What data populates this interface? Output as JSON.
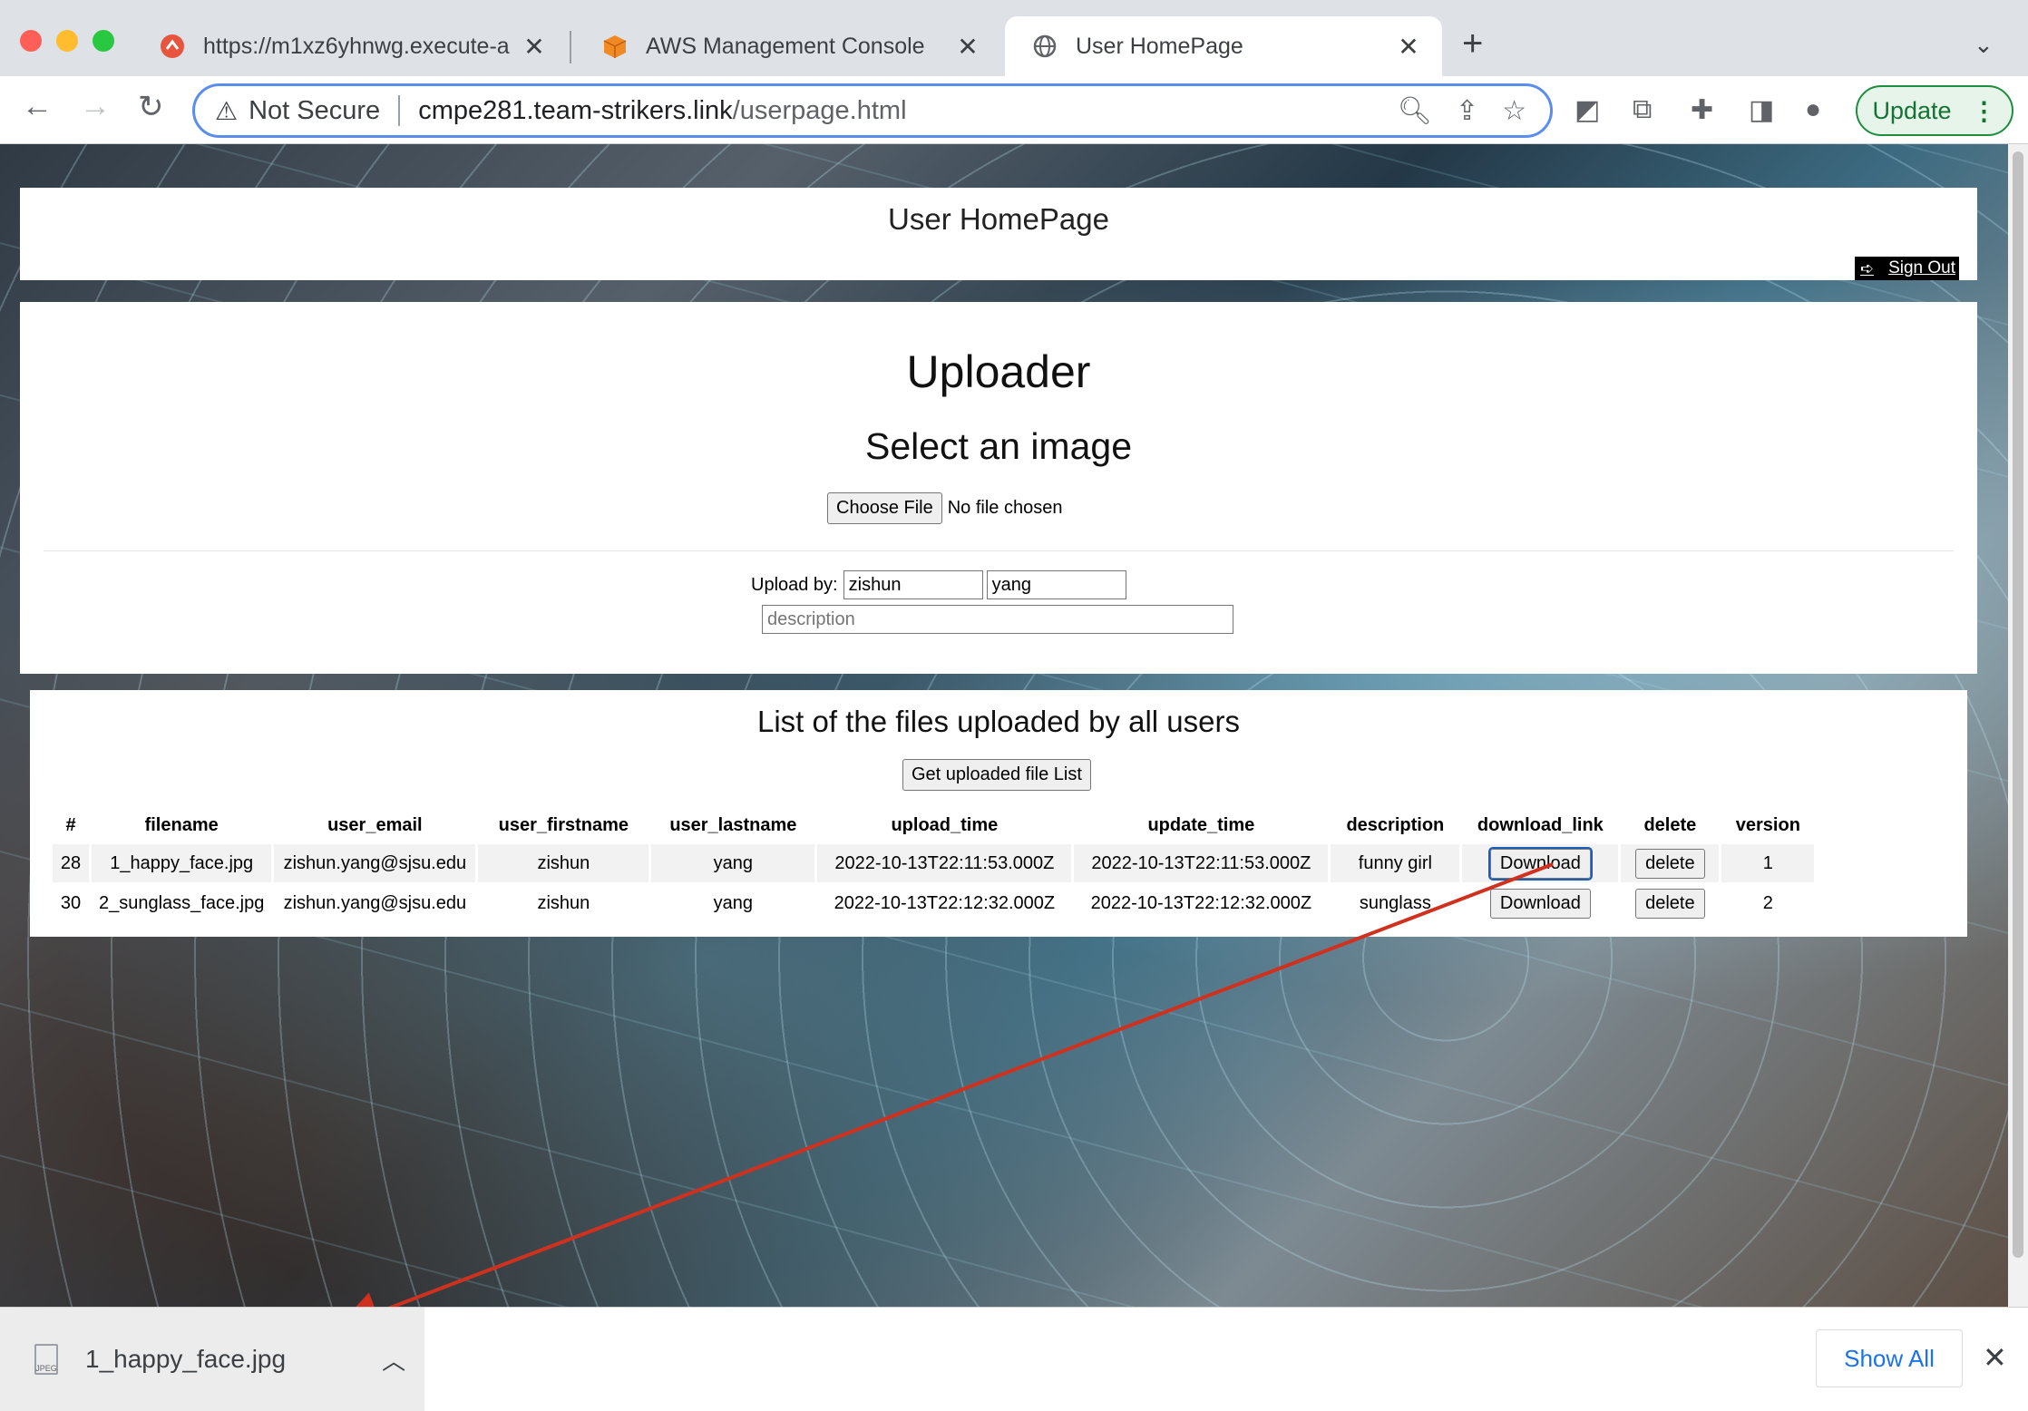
{
  "tabs": [
    {
      "title": "https://m1xz6yhnwg.execute-a",
      "icon": "api-gateway-icon"
    },
    {
      "title": "AWS Management Console",
      "icon": "aws-cube-icon"
    },
    {
      "title": "User HomePage",
      "icon": "globe-icon"
    }
  ],
  "toolbar": {
    "security_label": "Not Secure",
    "url_host": "cmpe281.team-strikers.link",
    "url_path": "/userpage.html",
    "update_label": "Update"
  },
  "page": {
    "title": "User HomePage",
    "signout_label": "Sign Out",
    "uploader_heading": "Uploader",
    "select_heading": "Select an image",
    "choose_file_label": "Choose File",
    "no_file_text": "No file chosen",
    "upload_by_label": "Upload by:",
    "firstname_value": "zishun",
    "lastname_value": "yang",
    "description_placeholder": "description",
    "list_heading": "List of the files uploaded by all users",
    "get_list_label": "Get uploaded file List"
  },
  "table": {
    "headers": [
      "#",
      "filename",
      "user_email",
      "user_firstname",
      "user_lastname",
      "upload_time",
      "update_time",
      "description",
      "download_link",
      "delete",
      "version"
    ],
    "rows": [
      {
        "id": "28",
        "filename": "1_happy_face.jpg",
        "email": "zishun.yang@sjsu.edu",
        "firstname": "zishun",
        "lastname": "yang",
        "upload_time": "2022-10-13T22:11:53.000Z",
        "update_time": "2022-10-13T22:11:53.000Z",
        "description": "funny girl",
        "download": "Download",
        "delete": "delete",
        "version": "1"
      },
      {
        "id": "30",
        "filename": "2_sunglass_face.jpg",
        "email": "zishun.yang@sjsu.edu",
        "firstname": "zishun",
        "lastname": "yang",
        "upload_time": "2022-10-13T22:12:32.000Z",
        "update_time": "2022-10-13T22:12:32.000Z",
        "description": "sunglass",
        "download": "Download",
        "delete": "delete",
        "version": "2"
      }
    ]
  },
  "downloads": {
    "file_name": "1_happy_face.jpg",
    "show_all_label": "Show All"
  },
  "colors": {
    "annotation_arrow": "#d0311f",
    "update_green": "#1e8e3e",
    "link_blue": "#1a73e8"
  }
}
